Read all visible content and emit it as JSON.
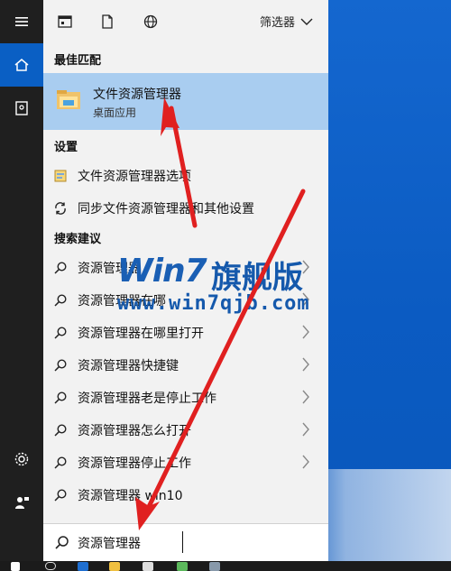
{
  "top": {
    "filter_label": "筛选器"
  },
  "sections": {
    "best_match": "最佳匹配",
    "settings": "设置",
    "suggestions": "搜索建议"
  },
  "best_match": {
    "title": "文件资源管理器",
    "subtitle": "桌面应用"
  },
  "settings_items": [
    {
      "label": "文件资源管理器选项"
    },
    {
      "label": "同步文件资源管理器和其他设置"
    }
  ],
  "suggestions": [
    {
      "label": "资源管理器"
    },
    {
      "label": "资源管理器在哪"
    },
    {
      "label": "资源管理器在哪里打开"
    },
    {
      "label": "资源管理器快捷键"
    },
    {
      "label": "资源管理器老是停止工作"
    },
    {
      "label": "资源管理器怎么打开"
    },
    {
      "label": "资源管理器停止工作"
    },
    {
      "label": "资源管理器 win10"
    }
  ],
  "search": {
    "value": "资源管理器"
  },
  "watermark": {
    "logo": "Win7",
    "cn": "旗舰版",
    "url": "www.win7qjb.com"
  },
  "colors": {
    "accent": "#0a5fc4",
    "selection": "#a9cdf0",
    "arrow": "#e02020",
    "rail": "#1f1f1f",
    "panel": "#f2f2f2"
  }
}
